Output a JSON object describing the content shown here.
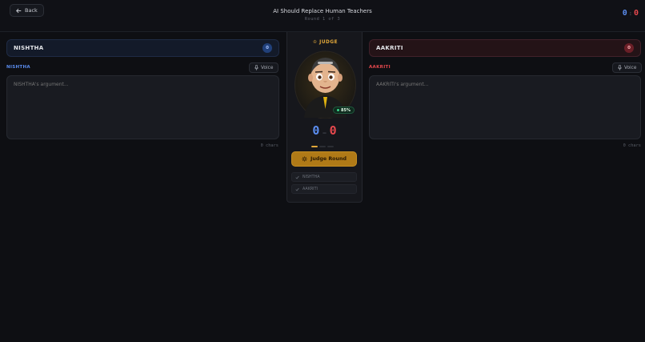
{
  "header": {
    "back_label": "Back",
    "title": "AI Should Replace Human Teachers",
    "round": "Round 1 of 3",
    "score_left": "0",
    "score_sep": ":",
    "score_right": "0"
  },
  "left": {
    "name": "NISHTHA",
    "count": "0",
    "label": "NISHTHA",
    "voice_label": "Voice",
    "placeholder": "NISHTHA's argument...",
    "chars": "0 chars",
    "accent": "#5b8def"
  },
  "right": {
    "name": "AAKRITI",
    "count": "0",
    "label": "AAKRITI",
    "voice_label": "Voice",
    "placeholder": "AAKRITI's argument...",
    "chars": "0 chars",
    "accent": "#e5484d"
  },
  "judge": {
    "title": "JUDGE",
    "confidence": "85%",
    "score_left": "0",
    "score_sep": "–",
    "score_right": "0",
    "button_label": "Judge Round",
    "checks": [
      "NISHTHA",
      "AAKRITI"
    ],
    "accent": "#e2a83a"
  },
  "icons": {
    "back": "arrow-left-icon",
    "voice": "microphone-icon",
    "judge": "crown-icon",
    "judge_button": "gear-icon",
    "check": "check-icon"
  }
}
